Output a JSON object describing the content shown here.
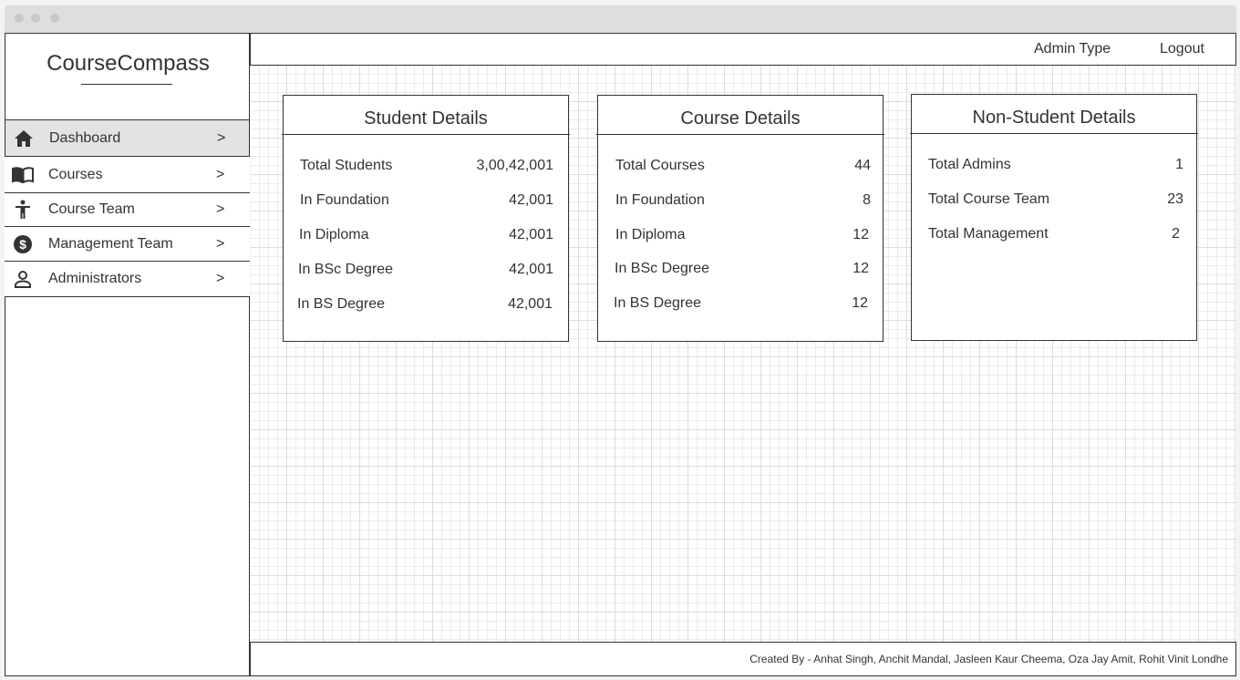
{
  "app": {
    "name": "CourseCompass"
  },
  "sidebar": {
    "items": [
      {
        "label": "Dashboard",
        "icon": "home-icon",
        "active": true
      },
      {
        "label": "Courses",
        "icon": "book-icon",
        "active": false
      },
      {
        "label": "Course Team",
        "icon": "person-icon",
        "active": false
      },
      {
        "label": "Management Team",
        "icon": "dollar-icon",
        "active": false
      },
      {
        "label": "Administrators",
        "icon": "user-icon",
        "active": false
      }
    ],
    "chevron": ">"
  },
  "header": {
    "admin_type": "Admin Type",
    "logout": "Logout"
  },
  "cards": {
    "student": {
      "title": "Student Details",
      "rows": [
        {
          "label": "Total Students",
          "value": "3,00,42,001"
        },
        {
          "label": "In Foundation",
          "value": "42,001"
        },
        {
          "label": "In Diploma",
          "value": "42,001"
        },
        {
          "label": "In BSc Degree",
          "value": "42,001"
        },
        {
          "label": "In BS Degree",
          "value": "42,001"
        }
      ]
    },
    "course": {
      "title": "Course Details",
      "rows": [
        {
          "label": "Total Courses",
          "value": "44"
        },
        {
          "label": "In Foundation",
          "value": "8"
        },
        {
          "label": "In Diploma",
          "value": "12"
        },
        {
          "label": "In BSc Degree",
          "value": "12"
        },
        {
          "label": "In BS Degree",
          "value": "12"
        }
      ]
    },
    "non_student": {
      "title": "Non-Student Details",
      "rows": [
        {
          "label": "Total Admins",
          "value": "1"
        },
        {
          "label": "Total Course Team",
          "value": "23"
        },
        {
          "label": "Total Management",
          "value": "2"
        }
      ]
    }
  },
  "footer": {
    "credits": "Created By - Anhat Singh, Anchit Mandal, Jasleen Kaur Cheema, Oza Jay Amit, Rohit Vinit Londhe"
  },
  "colors": {
    "border": "#333333",
    "active_item_bg": "#e3e3e3",
    "grid_line": "#ebebeb"
  }
}
